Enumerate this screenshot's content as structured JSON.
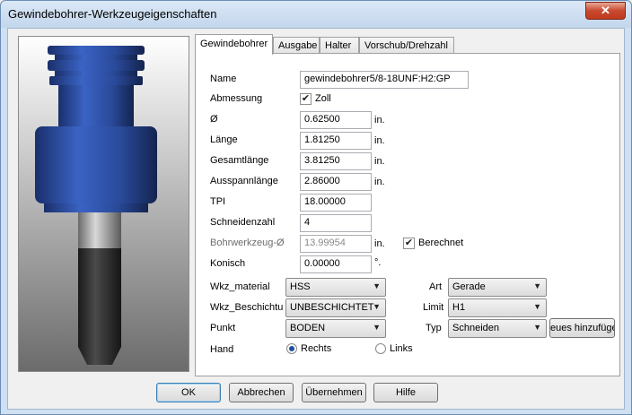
{
  "window": {
    "title": "Gewindebohrer-Werkzeugeigenschaften",
    "close_label": "✕"
  },
  "tabs": [
    "Gewindebohrer",
    "Ausgabe",
    "Halter",
    "Vorschub/Drehzahl"
  ],
  "form": {
    "name_label": "Name",
    "name_value": "gewindebohrer5/8-18UNF:H2:GP",
    "abmessung_label": "Abmessung",
    "zoll_label": "Zoll",
    "zoll_checked": true,
    "diameter_label": "Ø",
    "diameter_value": "0.62500",
    "diameter_unit": "in.",
    "laenge_label": "Länge",
    "laenge_value": "1.81250",
    "laenge_unit": "in.",
    "gesamtlaenge_label": "Gesamtlänge",
    "gesamtlaenge_value": "3.81250",
    "gesamtlaenge_unit": "in.",
    "ausspannlaenge_label": "Ausspannlänge",
    "ausspannlaenge_value": "2.86000",
    "ausspannlaenge_unit": "in.",
    "tpi_label": "TPI",
    "tpi_value": "18.00000",
    "schneidenzahl_label": "Schneidenzahl",
    "schneidenzahl_value": "4",
    "bohrwerkzeug_label": "Bohrwerkzeug-Ø",
    "bohrwerkzeug_value": "13.99954",
    "bohrwerkzeug_unit": "in.",
    "berechnet_label": "Berechnet",
    "berechnet_checked": true,
    "konisch_label": "Konisch",
    "konisch_value": "0.00000",
    "konisch_unit": "°.",
    "wkz_material_label": "Wkz_material",
    "wkz_material_value": "HSS",
    "wkz_beschichtung_label": "Wkz_Beschichtu",
    "wkz_beschichtung_value": "UNBESCHICHTET",
    "punkt_label": "Punkt",
    "punkt_value": "BODEN",
    "art_label": "Art",
    "art_value": "Gerade",
    "limit_label": "Limit",
    "limit_value": "H1",
    "typ_label": "Typ",
    "typ_value": "Schneiden",
    "neues_button": "eues hinzufüge",
    "hand_label": "Hand",
    "rechts_label": "Rechts",
    "links_label": "Links",
    "hand_selected": "Rechts"
  },
  "buttons": {
    "ok": "OK",
    "abbrechen": "Abbrechen",
    "uebernehmen": "Übernehmen",
    "hilfe": "Hilfe"
  },
  "colors": {
    "tool_blue": "#2a4a9a",
    "accent": "#3c7fb1"
  }
}
